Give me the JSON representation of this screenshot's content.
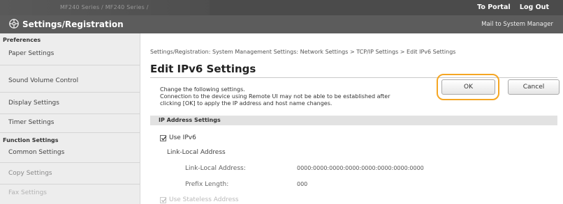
{
  "topbar": {
    "product_name": "MF240 Series / MF240 Series /",
    "to_portal": "To Portal",
    "log_out": "Log Out"
  },
  "header": {
    "title": "Settings/Registration",
    "mail_link": "Mail to System Manager",
    "icon": "settings-gear-icon"
  },
  "sidebar": {
    "preferences_title": "Preferences",
    "paper_settings": "Paper Settings",
    "sound_volume_control": "Sound Volume Control",
    "display_settings": "Display Settings",
    "timer_settings": "Timer Settings",
    "function_settings_title": "Function Settings",
    "common_settings": "Common Settings",
    "copy_settings": "Copy Settings",
    "fax_settings": "Fax Settings"
  },
  "main": {
    "breadcrumb": "Settings/Registration: System Management Settings: Network Settings > TCP/IP Settings > Edit IPv6 Settings",
    "page_title": "Edit IPv6 Settings",
    "description": {
      "line1": "Change the following settings.",
      "line2": "Connection to the device using Remote UI may not be able to be established after",
      "line3": "clicking [OK] to apply the IP address and host name changes."
    },
    "ok_button": "OK",
    "cancel_button": "Cancel",
    "section_title": "IP Address Settings",
    "use_ipv6_label": "Use IPv6",
    "use_ipv6_checked": true,
    "link_local_title": "Link-Local Address",
    "link_local_address_label": "Link-Local Address:",
    "link_local_address_value": "0000:0000:0000:0000:0000:0000:0000:0000",
    "prefix_length_label": "Prefix Length:",
    "prefix_length_value": "000",
    "use_stateless_label": "Use Stateless Address",
    "use_stateless_checked": true
  },
  "colors": {
    "topbar_bg": "#4b4b4b",
    "header_bg": "#5c5c5c",
    "highlight": "#f5a623",
    "sidebar_bg": "#ededed"
  }
}
